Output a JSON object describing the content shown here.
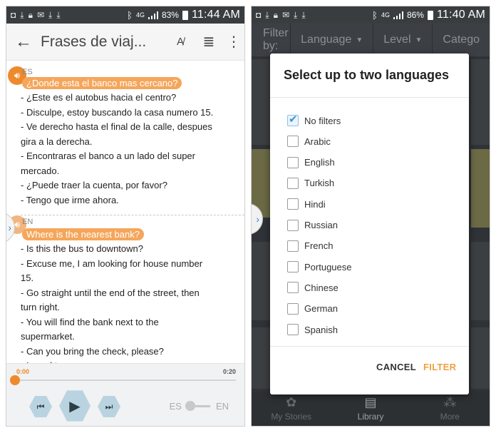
{
  "left": {
    "status": {
      "battery": "83%",
      "time": "11:44 AM"
    },
    "title": "Frases de viaj...",
    "spanish": {
      "tag": "ES",
      "highlight": "¿Donde esta el banco mas cercano?",
      "lines": [
        "- ¿Este es el autobus hacia el centro?",
        "- Disculpe, estoy buscando la casa numero 15.",
        "- Ve derecho hasta el final de la calle, despues",
        "gira a la derecha.",
        "- Encontraras el banco a un lado del super",
        "mercado.",
        "- ¿Puede traer la cuenta, por favor?",
        "- Tengo que irme ahora."
      ]
    },
    "english": {
      "tag": "EN",
      "highlight": "Where is the nearest bank?",
      "lines": [
        "- Is this the bus to downtown?",
        "- Excuse me, I am looking for house number",
        "15.",
        "- Go straight until the end of the street, then",
        "turn right.",
        "- You will find the bank next to the",
        "supermarket.",
        "- Can you bring the check, please?",
        "- I need to go now."
      ]
    },
    "player": {
      "current": "0:00",
      "total": "0:20",
      "progress": 0.0,
      "lang_left": "ES",
      "lang_right": "EN"
    }
  },
  "right": {
    "status": {
      "battery": "86%",
      "time": "11:40 AM"
    },
    "filterbar": {
      "label": "Filter by:",
      "language": "Language",
      "level": "Level",
      "category": "Catego"
    },
    "dialog": {
      "title": "Select up to two languages",
      "options": [
        {
          "label": "No filters",
          "checked": true
        },
        {
          "label": "Arabic",
          "checked": false
        },
        {
          "label": "English",
          "checked": false
        },
        {
          "label": "Turkish",
          "checked": false
        },
        {
          "label": "Hindi",
          "checked": false
        },
        {
          "label": "Russian",
          "checked": false
        },
        {
          "label": "French",
          "checked": false
        },
        {
          "label": "Portuguese",
          "checked": false
        },
        {
          "label": "Chinese",
          "checked": false
        },
        {
          "label": "German",
          "checked": false
        },
        {
          "label": "Spanish",
          "checked": false
        }
      ],
      "cancel": "CANCEL",
      "filter": "FILTER"
    },
    "nav": {
      "stories": "My Stories",
      "library": "Library",
      "more": "More"
    }
  },
  "colors": {
    "accent": "#ee8a2c",
    "highlight": "#f5a65b",
    "check": "#3a96d9",
    "filter_button": "#f0a040",
    "dark_bg": "#2f3236"
  }
}
